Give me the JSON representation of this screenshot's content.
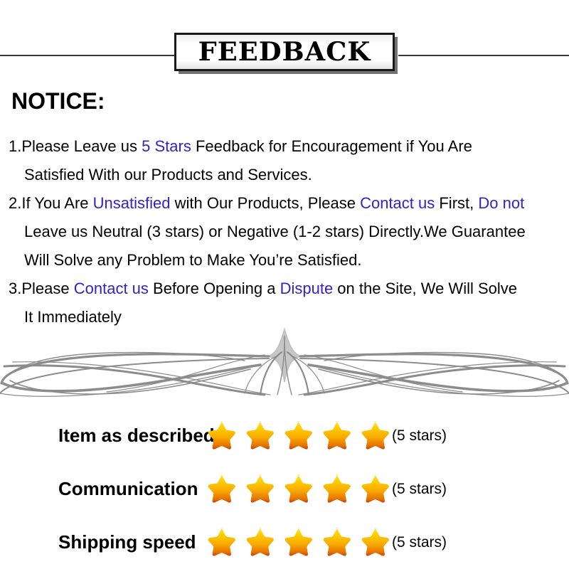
{
  "banner": {
    "title": "FEEDBACK"
  },
  "notice": {
    "heading": "NOTICE:",
    "lines": [
      [
        {
          "text": "1.Please Leave us  ",
          "highlight": false
        },
        {
          "text": "5 Stars",
          "highlight": true
        },
        {
          "text": "  Feedback for  Encouragement  if You Are",
          "highlight": false
        }
      ],
      [
        {
          "text": "Satisfied With our Products and Services.",
          "highlight": false
        }
      ],
      [
        {
          "text": "2.If You Are ",
          "highlight": false
        },
        {
          "text": "Unsatisfied",
          "highlight": true
        },
        {
          "text": " with Our Products, Please ",
          "highlight": false
        },
        {
          "text": "Contact us",
          "highlight": true
        },
        {
          "text": " First, ",
          "highlight": false
        },
        {
          "text": "Do not",
          "highlight": true
        }
      ],
      [
        {
          "text": "Leave us Neutral (3 stars) or Negative (1-2 stars) Directly.We Guarantee",
          "highlight": false
        }
      ],
      [
        {
          "text": "Will Solve any Problem to Make You’re  Satisfied.",
          "highlight": false
        }
      ],
      [
        {
          "text": "3.Please ",
          "highlight": false
        },
        {
          "text": "Contact us",
          "highlight": true
        },
        {
          "text": " Before Opening a ",
          "highlight": false
        },
        {
          "text": "Dispute",
          "highlight": true
        },
        {
          "text": " on the Site, We Will Solve",
          "highlight": false
        }
      ],
      [
        {
          "text": "It Immediately",
          "highlight": false
        }
      ]
    ],
    "indented": [
      false,
      true,
      false,
      true,
      true,
      false,
      true
    ],
    "highlight_color": "#3322cc"
  },
  "ornament": {
    "name": "pinstripe-flourish-divider",
    "color": "#8c8c8c"
  },
  "ratings": {
    "star_count": 5,
    "star_colors": {
      "top": "#ffd500",
      "mid": "#f7a800",
      "bottom": "#e06a00",
      "edge": "#c03a10"
    },
    "rows": [
      {
        "label": "Item as described",
        "stars": 5,
        "count_text": "(5 stars)"
      },
      {
        "label": "Communication",
        "stars": 5,
        "count_text": "(5 stars)"
      },
      {
        "label": "Shipping speed",
        "stars": 5,
        "count_text": "(5 stars)"
      }
    ]
  }
}
